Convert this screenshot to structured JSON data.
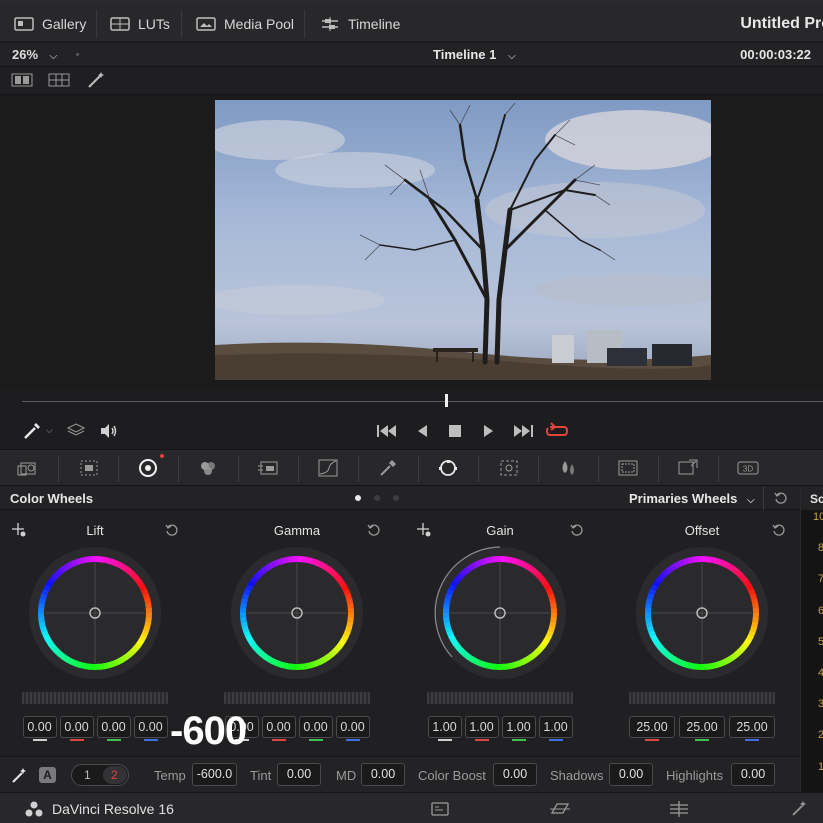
{
  "toolbar": {
    "gallery": "Gallery",
    "luts": "LUTs",
    "media_pool": "Media Pool",
    "timeline": "Timeline",
    "project_title": "Untitled Pro"
  },
  "viewer": {
    "zoom": "26%",
    "timeline_name": "Timeline 1",
    "timecode": "00:00:03:22",
    "playhead_progress": 0.53
  },
  "panel": {
    "title": "Color Wheels",
    "mode": "Primaries Wheels",
    "page_dots": [
      true,
      false,
      false
    ]
  },
  "wheels": [
    {
      "label": "Lift",
      "values": [
        "0.00",
        "0.00",
        "0.00",
        "0.00"
      ]
    },
    {
      "label": "Gamma",
      "values": [
        "0.00",
        "0.00",
        "0.00",
        "0.00"
      ]
    },
    {
      "label": "Gain",
      "values": [
        "1.00",
        "1.00",
        "1.00",
        "1.00"
      ]
    },
    {
      "label": "Offset",
      "values": [
        "25.00",
        "25.00",
        "25.00"
      ]
    }
  ],
  "overlay_value": "-600",
  "adjust": {
    "page_1": "1",
    "page_2": "2",
    "auto_label": "A",
    "temp_label": "Temp",
    "temp_value": "-600.0",
    "tint_label": "Tint",
    "tint_value": "0.00",
    "md_label": "MD",
    "md_value": "0.00",
    "color_boost_label": "Color Boost",
    "color_boost_value": "0.00",
    "shadows_label": "Shadows",
    "shadows_value": "0.00",
    "highlights_label": "Highlights",
    "highlights_value": "0.00"
  },
  "scopes": {
    "title": "Sc",
    "ticks": [
      "10",
      "8",
      "7",
      "6",
      "5",
      "4",
      "3",
      "2",
      "1"
    ]
  },
  "app": {
    "name": "DaVinci Resolve 16"
  },
  "colors": {
    "accent_red": "#e0443c",
    "mark_red": "#d9473d",
    "mark_green": "#3fbf4f",
    "mark_blue": "#3f6fe0",
    "mark_white": "#d0d0d0"
  }
}
